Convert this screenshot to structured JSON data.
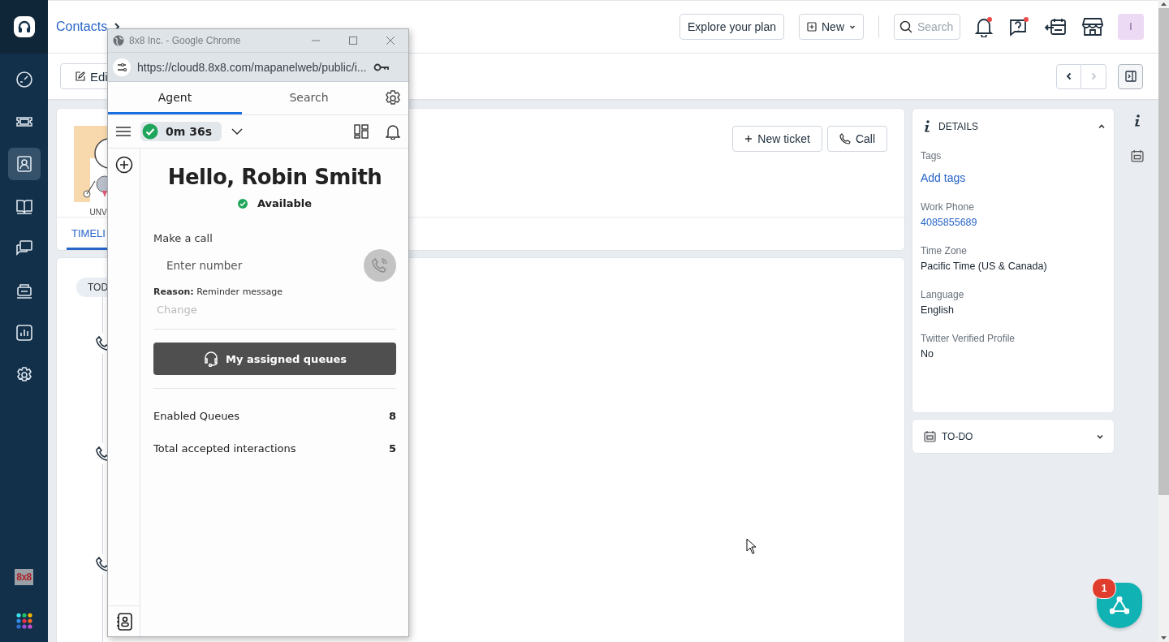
{
  "sidebar": {
    "nav_items": [
      {
        "kind": "gauge",
        "selected": false
      },
      {
        "kind": "ticket",
        "selected": false
      },
      {
        "kind": "contact",
        "selected": true
      },
      {
        "kind": "book",
        "selected": false
      },
      {
        "kind": "chat",
        "selected": false
      },
      {
        "kind": "bot",
        "selected": false
      },
      {
        "kind": "report",
        "selected": false
      },
      {
        "kind": "settings",
        "selected": false
      }
    ],
    "brand_badge": "8x8"
  },
  "header": {
    "breadcrumb": [
      "Contacts"
    ],
    "plan_button": "Explore your plan",
    "new_button": "New",
    "search": {
      "placeholder": "Search"
    },
    "notifications_unread": true,
    "help_unread": true,
    "avatar_initial": "I"
  },
  "toolbar": {
    "edit_button": "Edi",
    "prev_disabled": false,
    "next_disabled": true
  },
  "contact": {
    "avatar_caption": "UNV",
    "buttons": [
      "New ticket",
      "Call"
    ],
    "tabs": [
      {
        "label": "TIMELI",
        "selected": true
      }
    ]
  },
  "timeline": {
    "day_label": "TOD",
    "entries": [
      {
        "kind": "call"
      },
      {
        "kind": "call"
      },
      {
        "kind": "call"
      }
    ]
  },
  "details": {
    "title": "DETAILS",
    "expanded": true,
    "fields": [
      {
        "label": "Tags",
        "value": "Add tags",
        "kind": "link"
      },
      {
        "label": "Work Phone",
        "value": "4085855689",
        "kind": "link"
      },
      {
        "label": "Time Zone",
        "value": "Pacific Time (US & Canada)",
        "kind": "text"
      },
      {
        "label": "Language",
        "value": "English",
        "kind": "text"
      },
      {
        "label": "Twitter Verified Profile",
        "value": "No",
        "kind": "text"
      }
    ]
  },
  "todo": {
    "title": "TO-DO",
    "expanded": false
  },
  "fab": {
    "badge": "1"
  },
  "popup": {
    "window_title": "8x8 Inc. - Google Chrome",
    "url": "https://cloud8.8x8.com/mapanelweb/public/i...",
    "tabs": [
      {
        "label": "Agent",
        "selected": true
      },
      {
        "label": "Search",
        "selected": false
      }
    ],
    "timer": "0m 36s",
    "greeting": "Hello, Robin Smith",
    "status": "Available",
    "make_call": {
      "label": "Make a call",
      "placeholder": "Enter number"
    },
    "reason": "**Reason:** Reminder message",
    "change_link": "Change",
    "queues_button": "My assigned queues",
    "stats": [
      {
        "label": "Enabled Queues",
        "value": "8"
      },
      {
        "label": "Total accepted interactions",
        "value": "5"
      }
    ]
  }
}
